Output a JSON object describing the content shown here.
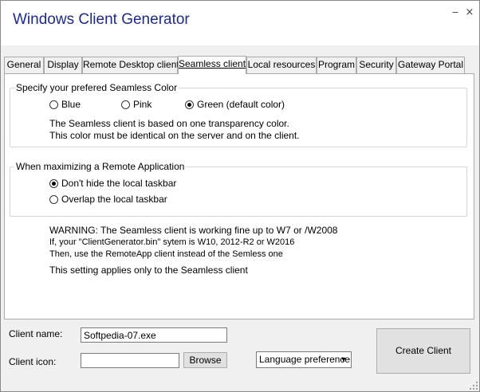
{
  "window": {
    "title": "Windows Client Generator",
    "minimize_glyph": "‒",
    "close_glyph": "×"
  },
  "tabs": [
    {
      "label": "General",
      "active": false
    },
    {
      "label": "Display",
      "active": false
    },
    {
      "label": "Remote Desktop client",
      "active": false
    },
    {
      "label": "Seamless client",
      "active": true
    },
    {
      "label": "Local resources",
      "active": false
    },
    {
      "label": "Program",
      "active": false
    },
    {
      "label": "Security",
      "active": false
    },
    {
      "label": "Gateway Portal",
      "active": false
    }
  ],
  "seamless_color": {
    "legend": "Specify your prefered Seamless Color",
    "options": [
      {
        "label": "Blue",
        "checked": false
      },
      {
        "label": "Pink",
        "checked": false
      },
      {
        "label": "Green (default color)",
        "checked": true
      }
    ],
    "note_line1": "The Seamless client is based on one transparency color.",
    "note_line2": "This color must be identical on the server and on the client."
  },
  "maximize": {
    "legend": "When maximizing a Remote Application",
    "options": [
      {
        "label": "Don't hide the local taskbar",
        "checked": true
      },
      {
        "label": "Overlap the local taskbar",
        "checked": false
      }
    ]
  },
  "warning": {
    "line1": "WARNING: The Seamless client is working fine up to W7 or /W2008",
    "line2": " If, your \"ClientGenerator.bin\" sytem is W10, 2012-R2 or W2016",
    "line3": " Then, use the RemoteApp client instead of the Semless one",
    "applies": "This setting applies only to the Seamless client"
  },
  "bottom": {
    "client_name_label": "Client name:",
    "client_name_value": "Softpedia-07.exe",
    "client_icon_label": "Client icon:",
    "client_icon_value": "",
    "browse_label": "Browse",
    "language_value": "Language preference",
    "create_label": "Create Client"
  }
}
